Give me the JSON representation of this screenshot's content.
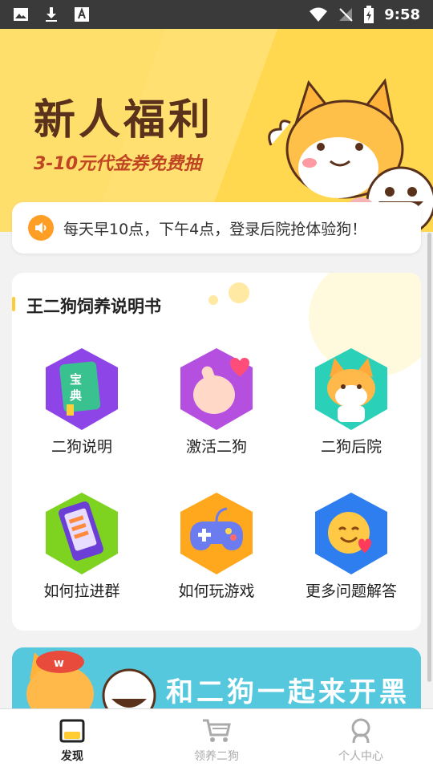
{
  "status_bar": {
    "time": "9:58"
  },
  "banner": {
    "title": "新人福利",
    "subtitle": "3-10元代金券免费抽"
  },
  "announcement": {
    "text": "每天早10点，下午4点，登录后院抢体验狗！"
  },
  "guide": {
    "title": "王二狗饲养说明书",
    "items": [
      {
        "label": "二狗说明",
        "icon": "book-icon"
      },
      {
        "label": "激活二狗",
        "icon": "finger-heart-icon"
      },
      {
        "label": "二狗后院",
        "icon": "shiba-icon"
      },
      {
        "label": "如何拉进群",
        "icon": "phone-icon"
      },
      {
        "label": "如何玩游戏",
        "icon": "gamepad-icon"
      },
      {
        "label": "更多问题解答",
        "icon": "emoji-heart-icon"
      }
    ]
  },
  "bottom_banner": {
    "text": "和二狗一起来开黑"
  },
  "tabs": [
    {
      "label": "发现",
      "active": true
    },
    {
      "label": "领养二狗",
      "active": false
    },
    {
      "label": "个人中心",
      "active": false
    }
  ]
}
